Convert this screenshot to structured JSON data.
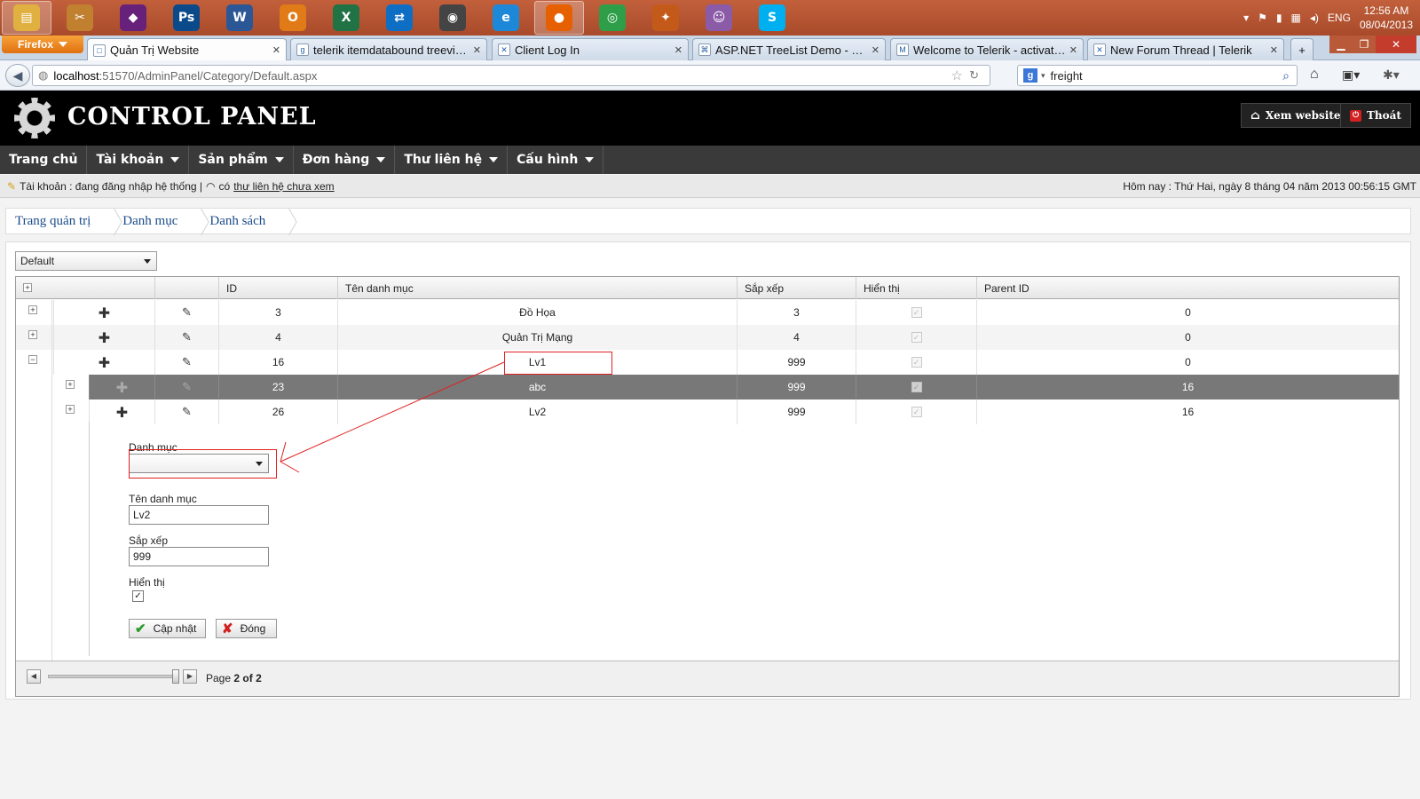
{
  "taskbar": {
    "apps": [
      {
        "name": "file-explorer-icon",
        "glyph": "▤",
        "color": "#e0b040"
      },
      {
        "name": "tools-icon",
        "glyph": "✂",
        "color": "#c08030"
      },
      {
        "name": "visual-studio-icon",
        "glyph": "◆",
        "color": "#68217a"
      },
      {
        "name": "photoshop-icon",
        "glyph": "Ps",
        "color": "#0b4a8a"
      },
      {
        "name": "word-icon",
        "glyph": "W",
        "color": "#2b5797"
      },
      {
        "name": "outlook-icon",
        "glyph": "O",
        "color": "#e07b18"
      },
      {
        "name": "excel-icon",
        "glyph": "X",
        "color": "#217346"
      },
      {
        "name": "teamviewer-icon",
        "glyph": "⇄",
        "color": "#0e6ec4"
      },
      {
        "name": "sourcetree-icon",
        "glyph": "◉",
        "color": "#444"
      },
      {
        "name": "ie-icon",
        "glyph": "e",
        "color": "#1e88d8"
      },
      {
        "name": "firefox-icon",
        "glyph": "●",
        "color": "#e66000"
      },
      {
        "name": "chrome-icon",
        "glyph": "◎",
        "color": "#2e9e48"
      },
      {
        "name": "filezilla-icon",
        "glyph": "✦",
        "color": "#c45a1a"
      },
      {
        "name": "pidgin-icon",
        "glyph": "☺",
        "color": "#8b5ba8"
      },
      {
        "name": "skype-icon",
        "glyph": "S",
        "color": "#00aff0"
      }
    ],
    "language": "ENG",
    "time": "12:56 AM",
    "date": "08/04/2013"
  },
  "browser": {
    "firefox_label": "Firefox",
    "tabs": [
      {
        "label": "Quản Trị Website",
        "active": true
      },
      {
        "label": "telerik itemdatabound treeview i..."
      },
      {
        "label": "Client Log In"
      },
      {
        "label": "ASP.NET TreeList Demo - Form ..."
      },
      {
        "label": "Welcome to Telerik - activate yo..."
      },
      {
        "label": "New Forum Thread | Telerik"
      }
    ],
    "url_host": "localhost",
    "url_path": ":51570/AdminPanel/Category/Default.aspx",
    "search_value": "freight"
  },
  "header": {
    "title": "CONTROL PANEL",
    "view_site_label": "Xem website",
    "logout_label": "Thoát"
  },
  "menu": {
    "items": [
      {
        "label": "Trang chủ",
        "dropdown": false
      },
      {
        "label": "Tài khoản",
        "dropdown": true
      },
      {
        "label": "Sản phẩm",
        "dropdown": true
      },
      {
        "label": "Đơn hàng",
        "dropdown": true
      },
      {
        "label": "Thư liên hệ",
        "dropdown": true
      },
      {
        "label": "Cấu hình",
        "dropdown": true
      }
    ]
  },
  "infobar": {
    "account_text": "Tài khoản : đang đăng nhập hệ thống |",
    "has_text": "có",
    "unread_link": "thư liên hệ chưa xem",
    "today_text": "Hôm nay : Thứ Hai, ngày 8 tháng 04 năm 2013 00:56:15 GMT"
  },
  "breadcrumb": [
    "Trang quản trị",
    "Danh mục",
    "Danh sách"
  ],
  "skin": {
    "selected": "Default"
  },
  "grid": {
    "columns": [
      "ID",
      "Tên danh mục",
      "Sắp xếp",
      "Hiển thị",
      "Parent ID"
    ],
    "rows": [
      {
        "id": "3",
        "name": "Đồ Họa",
        "order": "3",
        "visible": true,
        "parent": "0",
        "level": 0,
        "expander": "+"
      },
      {
        "id": "4",
        "name": "Quản Trị Mạng",
        "order": "4",
        "visible": true,
        "parent": "0",
        "level": 0,
        "expander": "+"
      },
      {
        "id": "16",
        "name": "Lv1",
        "order": "999",
        "visible": true,
        "parent": "0",
        "level": 0,
        "expander": "−"
      },
      {
        "id": "23",
        "name": "abc",
        "order": "999",
        "visible": true,
        "parent": "16",
        "level": 1,
        "expander": "+",
        "selected": true
      },
      {
        "id": "26",
        "name": "Lv2",
        "order": "999",
        "visible": true,
        "parent": "16",
        "level": 1,
        "expander": "+"
      }
    ]
  },
  "edit_form": {
    "category_label": "Danh mục",
    "category_value": "",
    "name_label": "Tên danh mục",
    "name_value": "Lv2",
    "order_label": "Sắp xếp",
    "order_value": "999",
    "visible_label": "Hiển thị",
    "visible_checked": true,
    "update_label": "Cập nhật",
    "close_label": "Đóng"
  },
  "pager": {
    "prefix": "Page",
    "current": "2",
    "sep": "of",
    "total": "2"
  }
}
